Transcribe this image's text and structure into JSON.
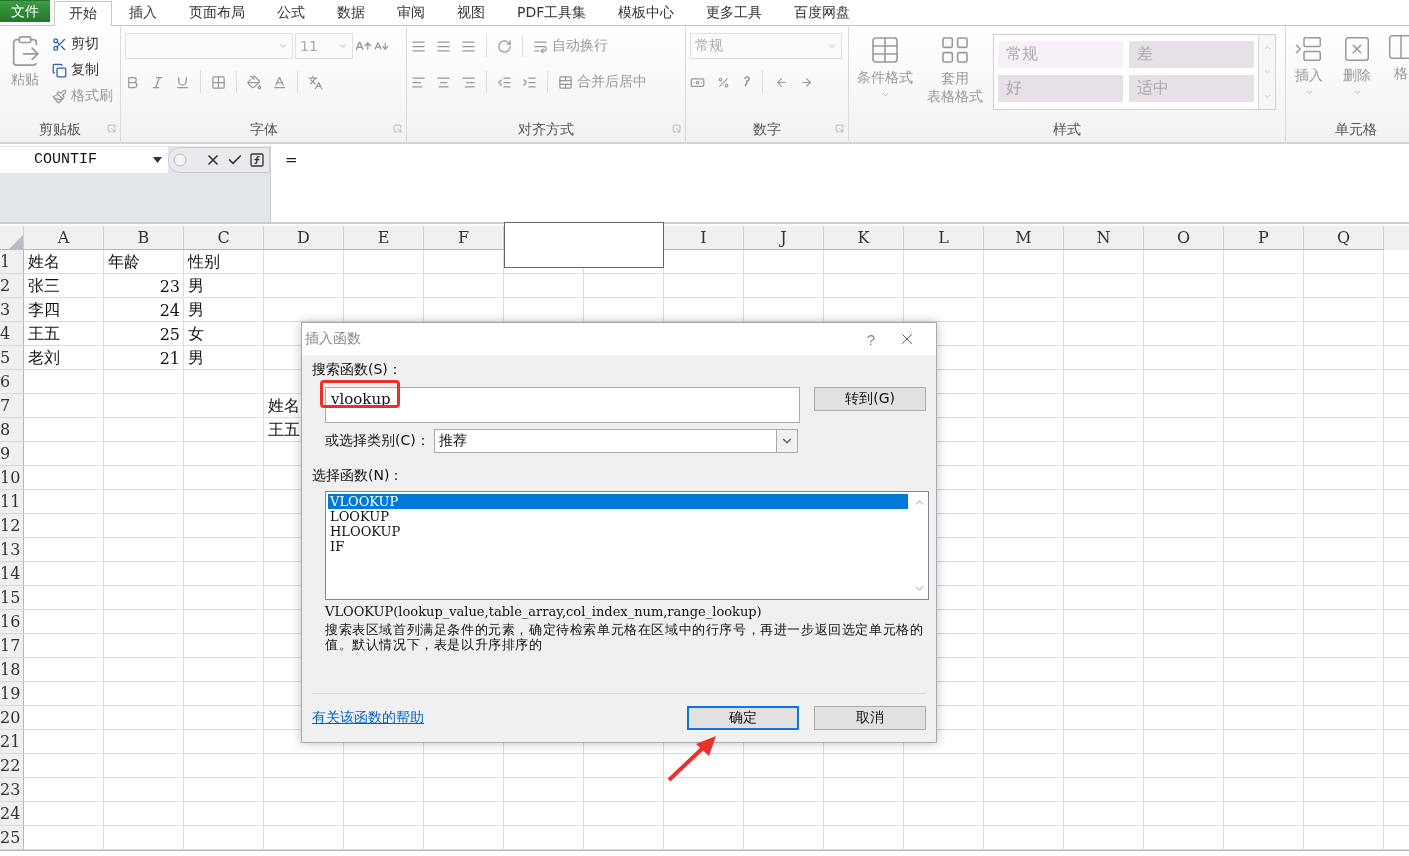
{
  "menu_tabs": [
    {
      "label": "文件",
      "kind": "file",
      "selected": false
    },
    {
      "label": "开始",
      "kind": "tab",
      "selected": true
    },
    {
      "label": "插入",
      "kind": "tab",
      "selected": false
    },
    {
      "label": "页面布局",
      "kind": "tab",
      "selected": false
    },
    {
      "label": "公式",
      "kind": "tab",
      "selected": false
    },
    {
      "label": "数据",
      "kind": "tab",
      "selected": false
    },
    {
      "label": "审阅",
      "kind": "tab",
      "selected": false
    },
    {
      "label": "视图",
      "kind": "tab",
      "selected": false
    },
    {
      "label": "PDF工具集",
      "kind": "tab",
      "selected": false
    },
    {
      "label": "模板中心",
      "kind": "tab",
      "selected": false
    },
    {
      "label": "更多工具",
      "kind": "tab",
      "selected": false
    },
    {
      "label": "百度网盘",
      "kind": "tab",
      "selected": false
    }
  ],
  "ribbon": {
    "clipboard": {
      "label": "剪贴板",
      "paste": "粘贴",
      "cut": "剪切",
      "copy": "复制",
      "format_painter": "格式刷"
    },
    "font": {
      "label": "字体",
      "size": "11"
    },
    "alignment": {
      "label": "对齐方式",
      "wrap_text": "自动换行",
      "merge_center": "合并后居中"
    },
    "number": {
      "label": "数字",
      "format": "常规"
    },
    "styles": {
      "label": "样式",
      "conditional_format": "条件格式",
      "table_format_top": "套用",
      "table_format_bottom": "表格格式",
      "gallery": [
        {
          "label": "常规",
          "color": "#f6f1f6"
        },
        {
          "label": "差",
          "color": "#e6e1e6"
        },
        {
          "label": "好",
          "color": "#e6e1e6"
        },
        {
          "label": "适中",
          "color": "#e6e1e6"
        }
      ]
    },
    "cells": {
      "label": "单元格",
      "insert": "插入",
      "delete": "删除",
      "format": "格"
    }
  },
  "formula_bar": {
    "name_box": "COUNTIF",
    "formula": "="
  },
  "sheet": {
    "columns": [
      {
        "label": "A"
      },
      {
        "label": "B"
      },
      {
        "label": "C"
      },
      {
        "label": "D"
      },
      {
        "label": "E"
      },
      {
        "label": "F"
      },
      {},
      {},
      {
        "label": "I"
      },
      {
        "label": "J"
      },
      {
        "label": "K"
      },
      {
        "label": "L"
      },
      {
        "label": "M"
      },
      {
        "label": "N"
      },
      {
        "label": "O"
      },
      {
        "label": "P"
      },
      {
        "label": "Q"
      }
    ],
    "rows": [
      {
        "number": "1",
        "cells": [
          {
            "text": "姓名",
            "kind": "text"
          },
          {
            "text": "年龄",
            "kind": "text"
          },
          {
            "text": "性别",
            "kind": "text"
          }
        ]
      },
      {
        "number": "2",
        "cells": [
          {
            "text": "张三",
            "kind": "text"
          },
          {
            "text": "23",
            "kind": "number"
          },
          {
            "text": "男",
            "kind": "text"
          }
        ]
      },
      {
        "number": "3",
        "cells": [
          {
            "text": "李四",
            "kind": "text"
          },
          {
            "text": "24",
            "kind": "number"
          },
          {
            "text": "男",
            "kind": "text"
          }
        ]
      },
      {
        "number": "4",
        "cells": [
          {
            "text": "王五",
            "kind": "text"
          },
          {
            "text": "25",
            "kind": "number"
          },
          {
            "text": "女",
            "kind": "text"
          }
        ]
      },
      {
        "number": "5",
        "cells": [
          {
            "text": "老刘",
            "kind": "text"
          },
          {
            "text": "21",
            "kind": "number"
          },
          {
            "text": "男",
            "kind": "text"
          }
        ]
      },
      {
        "number": "6"
      },
      {
        "number": "7",
        "cells": [
          null,
          null,
          null,
          {
            "text": "姓名",
            "kind": "text"
          }
        ]
      },
      {
        "number": "8",
        "cells": [
          null,
          null,
          null,
          {
            "text": "王五",
            "kind": "text"
          }
        ]
      },
      {
        "number": "9"
      },
      {
        "number": "10"
      },
      {
        "number": "11"
      },
      {
        "number": "12"
      },
      {
        "number": "13"
      },
      {
        "number": "14"
      },
      {
        "number": "15"
      },
      {
        "number": "16"
      },
      {
        "number": "17"
      },
      {
        "number": "18"
      },
      {
        "number": "19"
      },
      {
        "number": "20"
      },
      {
        "number": "21"
      },
      {
        "number": "22"
      },
      {
        "number": "23"
      },
      {
        "number": "24"
      },
      {
        "number": "25"
      }
    ]
  },
  "dialog": {
    "title": "插入函数",
    "help": "?",
    "search_label": "搜索函数(S)：",
    "search_value": "vlookup",
    "go_button": "转到(G)",
    "category_label": "或选择类别(C)：",
    "category_value": "推荐",
    "function_label": "选择函数(N)：",
    "functions": [
      {
        "name": "VLOOKUP",
        "selected": true
      },
      {
        "name": "LOOKUP",
        "selected": false
      },
      {
        "name": "HLOOKUP",
        "selected": false
      },
      {
        "name": "IF",
        "selected": false
      }
    ],
    "signature": "VLOOKUP(lookup_value,table_array,col_index_num,range_lookup)",
    "description": "搜索表区域首列满足条件的元素，确定待检索单元格在区域中的行序号，再进一步返回选定单元格的值。默认情况下，表是以升序排序的",
    "help_link": "有关该函数的帮助",
    "ok_button": "确定",
    "cancel_button": "取消"
  }
}
